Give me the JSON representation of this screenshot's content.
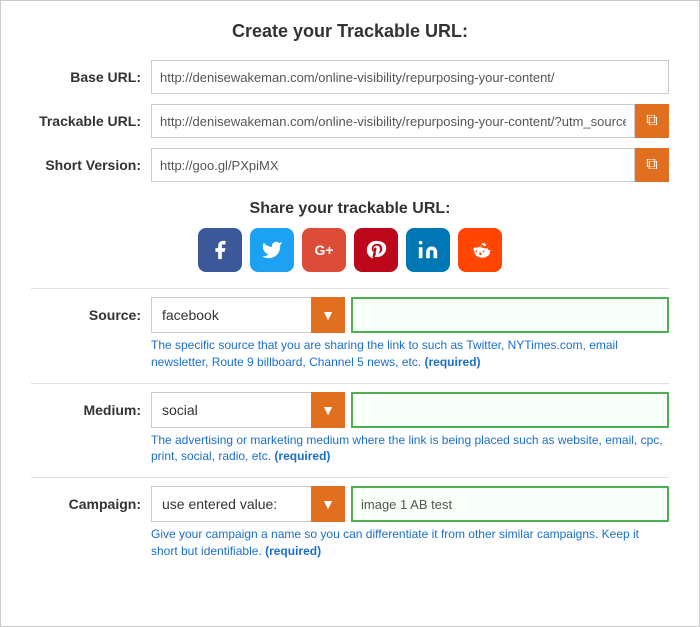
{
  "page": {
    "title": "Create your Trackable URL:",
    "share_title": "Share your trackable URL:"
  },
  "fields": {
    "base_url_label": "Base URL:",
    "base_url_value": "http://denisewakeman.com/online-visibility/repurposing-your-content/",
    "trackable_url_label": "Trackable URL:",
    "trackable_url_value": "http://denisewakeman.com/online-visibility/repurposing-your-content/?utm_source",
    "short_version_label": "Short Version:",
    "short_version_value": "http://goo.gl/PXpiMX"
  },
  "source": {
    "label": "Source:",
    "dropdown_value": "facebook",
    "input_placeholder": "",
    "hint": "The specific source that you are sharing the link to such as Twitter, NYTimes.com, email newsletter, Route 9 billboard, Channel 5 news, etc.",
    "hint_required": "(required)"
  },
  "medium": {
    "label": "Medium:",
    "dropdown_value": "social",
    "input_placeholder": "",
    "hint": "The advertising or marketing medium where the link is being placed such as website, email, cpc, print, social, radio, etc.",
    "hint_required": "(required)"
  },
  "campaign": {
    "label": "Campaign:",
    "dropdown_value": "use entered value:",
    "input_value": "image 1 AB test",
    "hint": "Give your campaign a name so you can differentiate it from other similar campaigns. Keep it short but identifiable.",
    "hint_required": "(required)"
  },
  "social": {
    "facebook": "f",
    "twitter": "t",
    "googleplus": "g+",
    "pinterest": "p",
    "linkedin": "in",
    "reddit": "r"
  },
  "copy_icon": "❐",
  "dropdown_arrow": "▼"
}
